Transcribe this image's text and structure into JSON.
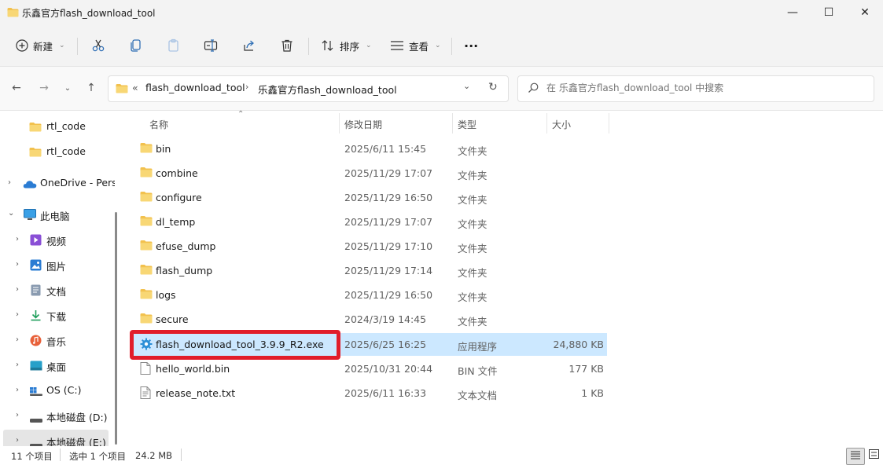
{
  "window": {
    "title": "乐鑫官方flash_download_tool",
    "controls": {
      "minimize": "—",
      "maximize": "☐",
      "close": "✕"
    }
  },
  "toolbar": {
    "new_label": "新建",
    "sort_label": "排序",
    "view_label": "查看",
    "more_label": "···",
    "icons": [
      "cut-icon",
      "copy-icon",
      "paste-icon",
      "rename-icon",
      "share-icon",
      "delete-icon"
    ]
  },
  "address": {
    "overflow": "«",
    "crumbs": [
      "flash_download_tool",
      "乐鑫官方flash_download_tool"
    ],
    "search_placeholder": "在 乐鑫官方flash_download_tool 中搜索"
  },
  "sidebar": {
    "items": [
      {
        "label": "rtl_code",
        "icon": "folder-icon"
      },
      {
        "label": "rtl_code",
        "icon": "folder-icon"
      },
      {
        "label": "OneDrive - Pers",
        "icon": "onedrive-icon"
      },
      {
        "label": "此电脑",
        "icon": "computer-icon"
      },
      {
        "label": "视频",
        "icon": "video-icon"
      },
      {
        "label": "图片",
        "icon": "pictures-icon"
      },
      {
        "label": "文档",
        "icon": "documents-icon"
      },
      {
        "label": "下载",
        "icon": "download-icon"
      },
      {
        "label": "音乐",
        "icon": "music-icon"
      },
      {
        "label": "桌面",
        "icon": "desktop-icon"
      },
      {
        "label": "OS (C:)",
        "icon": "windows-drive-icon"
      },
      {
        "label": "本地磁盘 (D:)",
        "icon": "drive-icon"
      },
      {
        "label": "本地磁盘 (E:)",
        "icon": "drive-icon"
      }
    ]
  },
  "columns": {
    "name": "名称",
    "date": "修改日期",
    "type": "类型",
    "size": "大小"
  },
  "files": [
    {
      "name": "bin",
      "date": "2025/6/11 15:45",
      "type": "文件夹",
      "size": "",
      "icon": "folder-icon"
    },
    {
      "name": "combine",
      "date": "2025/11/29 17:07",
      "type": "文件夹",
      "size": "",
      "icon": "folder-icon"
    },
    {
      "name": "configure",
      "date": "2025/11/29 16:50",
      "type": "文件夹",
      "size": "",
      "icon": "folder-icon"
    },
    {
      "name": "dl_temp",
      "date": "2025/11/29 17:07",
      "type": "文件夹",
      "size": "",
      "icon": "folder-icon"
    },
    {
      "name": "efuse_dump",
      "date": "2025/11/29 17:10",
      "type": "文件夹",
      "size": "",
      "icon": "folder-icon"
    },
    {
      "name": "flash_dump",
      "date": "2025/11/29 17:14",
      "type": "文件夹",
      "size": "",
      "icon": "folder-icon"
    },
    {
      "name": "logs",
      "date": "2025/11/29 16:50",
      "type": "文件夹",
      "size": "",
      "icon": "folder-icon"
    },
    {
      "name": "secure",
      "date": "2024/3/19 14:45",
      "type": "文件夹",
      "size": "",
      "icon": "folder-icon"
    },
    {
      "name": "flash_download_tool_3.9.9_R2.exe",
      "date": "2025/6/25 16:25",
      "type": "应用程序",
      "size": "24,880 KB",
      "icon": "gear-app-icon"
    },
    {
      "name": "hello_world.bin",
      "date": "2025/10/31 20:44",
      "type": "BIN 文件",
      "size": "177 KB",
      "icon": "file-icon"
    },
    {
      "name": "release_note.txt",
      "date": "2025/6/11 16:33",
      "type": "文本文档",
      "size": "1 KB",
      "icon": "text-file-icon"
    }
  ],
  "status": {
    "count": "11 个项目",
    "selection": "选中 1 个项目",
    "selection_size": "24.2 MB"
  },
  "colors": {
    "selected_row": "#cce8ff",
    "highlight_box": "#e11d2a",
    "folder": "#f2c14e"
  }
}
